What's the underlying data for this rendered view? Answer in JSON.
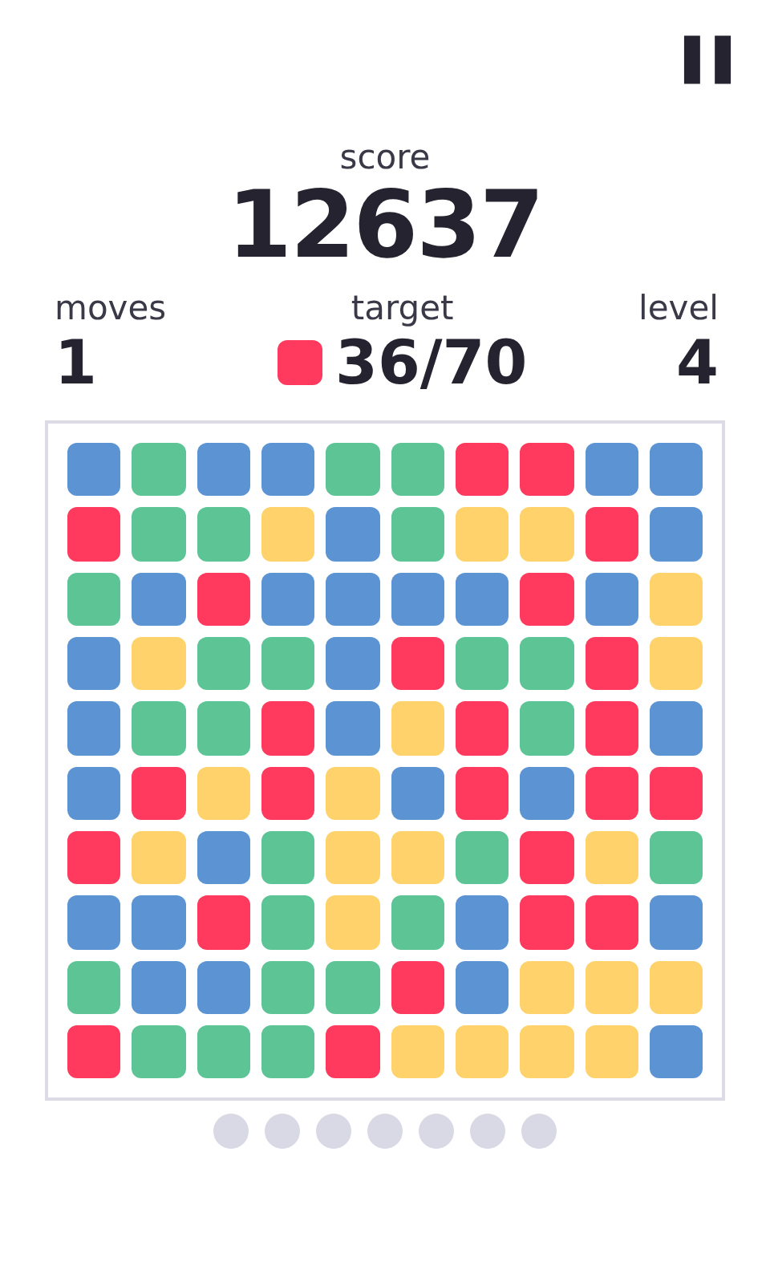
{
  "pause_button": {
    "label": "❚❚"
  },
  "score": {
    "label": "score",
    "value": "12637"
  },
  "stats": [
    {
      "kind": "moves",
      "label": "moves",
      "value": "1"
    },
    {
      "kind": "target",
      "label": "target",
      "value": "36/70",
      "color": "#ff3a5e"
    },
    {
      "kind": "level",
      "label": "level",
      "value": "4"
    }
  ],
  "board": {
    "rows": [
      [
        {
          "color": "#5b93d3"
        },
        {
          "color": "#5cc495"
        },
        {
          "color": "#5b93d3"
        },
        {
          "color": "#5b93d3"
        },
        {
          "color": "#5cc495"
        },
        {
          "color": "#5cc495"
        },
        {
          "color": "#ff3a5e"
        },
        {
          "color": "#ff3a5e"
        },
        {
          "color": "#5b93d3"
        },
        {
          "color": "#5b93d3"
        }
      ],
      [
        {
          "color": "#ff3a5e"
        },
        {
          "color": "#5cc495"
        },
        {
          "color": "#5cc495"
        },
        {
          "color": "#ffd26b"
        },
        {
          "color": "#5b93d3"
        },
        {
          "color": "#5cc495"
        },
        {
          "color": "#ffd26b"
        },
        {
          "color": "#ffd26b"
        },
        {
          "color": "#ff3a5e"
        },
        {
          "color": "#5b93d3"
        }
      ],
      [
        {
          "color": "#5cc495"
        },
        {
          "color": "#5b93d3"
        },
        {
          "color": "#ff3a5e"
        },
        {
          "color": "#5b93d3"
        },
        {
          "color": "#5b93d3"
        },
        {
          "color": "#5b93d3"
        },
        {
          "color": "#5b93d3"
        },
        {
          "color": "#ff3a5e"
        },
        {
          "color": "#5b93d3"
        },
        {
          "color": "#ffd26b"
        }
      ],
      [
        {
          "color": "#5b93d3"
        },
        {
          "color": "#ffd26b"
        },
        {
          "color": "#5cc495"
        },
        {
          "color": "#5cc495"
        },
        {
          "color": "#5b93d3"
        },
        {
          "color": "#ff3a5e"
        },
        {
          "color": "#5cc495"
        },
        {
          "color": "#5cc495"
        },
        {
          "color": "#ff3a5e"
        },
        {
          "color": "#ffd26b"
        }
      ],
      [
        {
          "color": "#5b93d3"
        },
        {
          "color": "#5cc495"
        },
        {
          "color": "#5cc495"
        },
        {
          "color": "#ff3a5e"
        },
        {
          "color": "#5b93d3"
        },
        {
          "color": "#ffd26b"
        },
        {
          "color": "#ff3a5e"
        },
        {
          "color": "#5cc495"
        },
        {
          "color": "#ff3a5e"
        },
        {
          "color": "#5b93d3"
        }
      ],
      [
        {
          "color": "#5b93d3"
        },
        {
          "color": "#ff3a5e"
        },
        {
          "color": "#ffd26b"
        },
        {
          "color": "#ff3a5e"
        },
        {
          "color": "#ffd26b"
        },
        {
          "color": "#5b93d3"
        },
        {
          "color": "#ff3a5e"
        },
        {
          "color": "#5b93d3"
        },
        {
          "color": "#ff3a5e"
        },
        {
          "color": "#ff3a5e"
        }
      ],
      [
        {
          "color": "#ff3a5e"
        },
        {
          "color": "#ffd26b"
        },
        {
          "color": "#5b93d3"
        },
        {
          "color": "#5cc495"
        },
        {
          "color": "#ffd26b"
        },
        {
          "color": "#ffd26b"
        },
        {
          "color": "#5cc495"
        },
        {
          "color": "#ff3a5e"
        },
        {
          "color": "#ffd26b"
        },
        {
          "color": "#5cc495"
        }
      ],
      [
        {
          "color": "#5b93d3"
        },
        {
          "color": "#5b93d3"
        },
        {
          "color": "#ff3a5e"
        },
        {
          "color": "#5cc495"
        },
        {
          "color": "#ffd26b"
        },
        {
          "color": "#5cc495"
        },
        {
          "color": "#5b93d3"
        },
        {
          "color": "#ff3a5e"
        },
        {
          "color": "#ff3a5e"
        },
        {
          "color": "#5b93d3"
        }
      ],
      [
        {
          "color": "#5cc495"
        },
        {
          "color": "#5b93d3"
        },
        {
          "color": "#5b93d3"
        },
        {
          "color": "#5cc495"
        },
        {
          "color": "#5cc495"
        },
        {
          "color": "#ff3a5e"
        },
        {
          "color": "#5b93d3"
        },
        {
          "color": "#ffd26b"
        },
        {
          "color": "#ffd26b"
        },
        {
          "color": "#ffd26b"
        }
      ],
      [
        {
          "color": "#ff3a5e"
        },
        {
          "color": "#5cc495"
        },
        {
          "color": "#5cc495"
        },
        {
          "color": "#5cc495"
        },
        {
          "color": "#ff3a5e"
        },
        {
          "color": "#ffd26b"
        },
        {
          "color": "#ffd26b"
        },
        {
          "color": "#ffd26b"
        },
        {
          "color": "#ffd26b"
        },
        {
          "color": "#5b93d3"
        }
      ]
    ]
  },
  "page_dots": [
    {
      "selected": false
    },
    {
      "selected": false
    },
    {
      "selected": false
    },
    {
      "selected": false
    },
    {
      "selected": false
    },
    {
      "selected": false
    },
    {
      "selected": false
    }
  ]
}
